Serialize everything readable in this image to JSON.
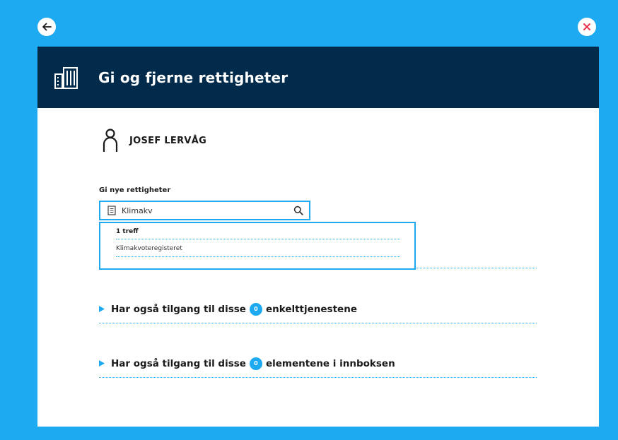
{
  "nav": {
    "back_icon": "arrow-left-icon",
    "close_icon": "close-x-icon",
    "close_color": "#e8344a"
  },
  "header": {
    "title": "Gi og fjerne rettigheter",
    "icon": "building-icon",
    "background": "#022a4a"
  },
  "person": {
    "icon": "person-icon",
    "name": "JOSEF LERVÅG"
  },
  "grant": {
    "label": "Gi nye rettigheter",
    "search": {
      "value": "Klimakv",
      "icon_left": "document-icon",
      "icon_right": "search-icon"
    },
    "results": {
      "count_label": "1 treff",
      "items": [
        "Klimakvoteregisteret"
      ]
    }
  },
  "expanders": [
    {
      "prefix": "Har også tilgang til disse",
      "count": "0",
      "suffix": "enkelttjenestene"
    },
    {
      "prefix": "Har også tilgang til disse",
      "count": "0",
      "suffix": "elementene i innboksen"
    }
  ],
  "colors": {
    "accent": "#1eaaf1",
    "page_bg": "#1eaaf1",
    "text": "#1a1a1a"
  }
}
